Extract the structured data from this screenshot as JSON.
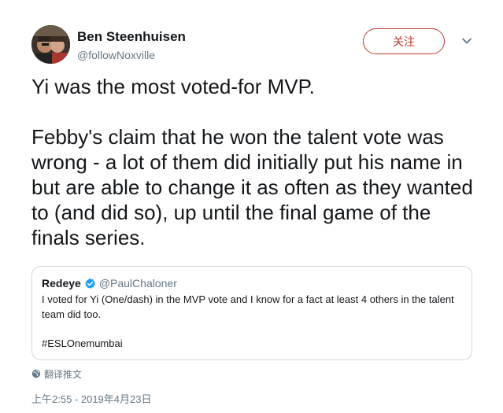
{
  "author": {
    "display_name": "Ben Steenhuisen",
    "handle": "@followNoxville",
    "avatar_icon": "avatar-photo"
  },
  "actions": {
    "follow_label": "关注",
    "more_icon": "chevron-down-icon"
  },
  "tweet": {
    "paragraph_1": "Yi was the most voted-for MVP.",
    "paragraph_2": "Febby's claim that he won the talent vote was wrong - a lot of them did initially put his name in but are able to change it as often as they wanted to (and did so), up until the final game of the finals series."
  },
  "quoted": {
    "display_name": "Redeye",
    "verified_icon": "verified-badge-icon",
    "handle": "@PaulChaloner",
    "text": "I voted for Yi (One/dash) in the MVP vote and I know for a fact at least 4 others in the talent team did too.",
    "hashtag": "#ESLOnemumbai"
  },
  "translate": {
    "label": "翻译推文",
    "icon": "globe-icon"
  },
  "timestamp": "上午2:55 - 2019年4月23日",
  "colors": {
    "follow_accent": "#c0392b",
    "verified_blue": "#1da1f2",
    "muted_text": "#657786",
    "border": "#ccd6dd"
  }
}
